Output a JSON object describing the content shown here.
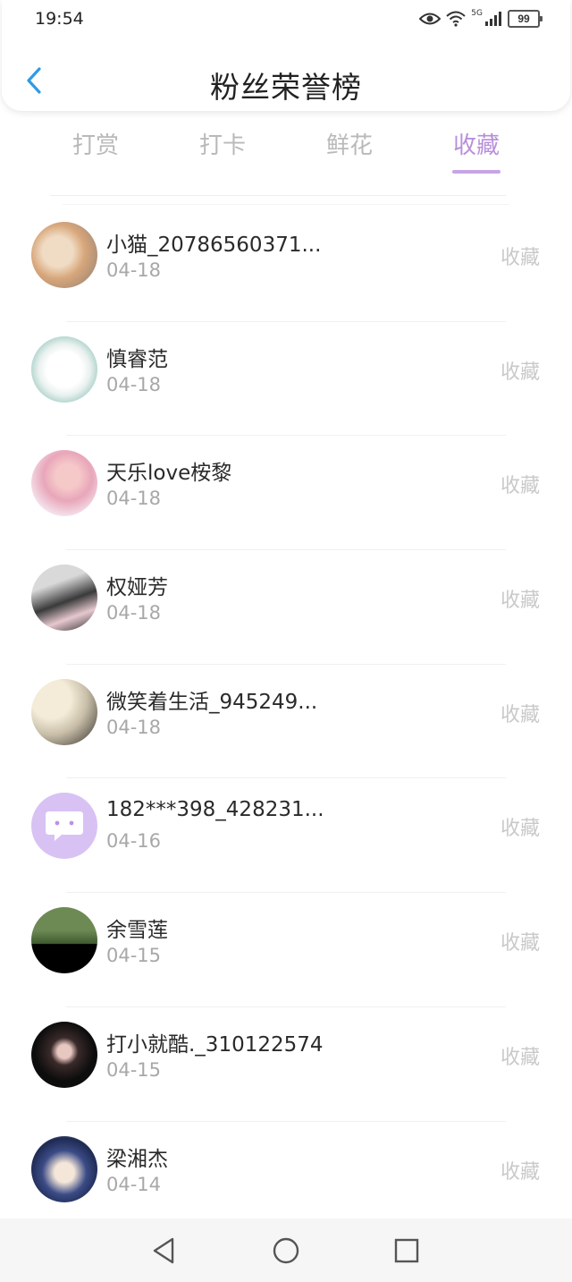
{
  "status_bar": {
    "time": "19:54",
    "signal_label": "5G",
    "battery": "99"
  },
  "header": {
    "title": "粉丝荣誉榜"
  },
  "tabs": [
    {
      "label": "打赏",
      "active": false
    },
    {
      "label": "打卡",
      "active": false
    },
    {
      "label": "鲜花",
      "active": false
    },
    {
      "label": "收藏",
      "active": true
    }
  ],
  "fans": [
    {
      "name": "小猫_20786560371...",
      "date": "04-18",
      "action": "收藏"
    },
    {
      "name": "慎睿范",
      "date": "04-18",
      "action": "收藏"
    },
    {
      "name": "天乐love桉黎",
      "date": "04-18",
      "action": "收藏"
    },
    {
      "name": "权娅芳",
      "date": "04-18",
      "action": "收藏"
    },
    {
      "name": "微笑着生活_945249...",
      "date": "04-18",
      "action": "收藏"
    },
    {
      "name": "182***398_428231...",
      "date": "04-16",
      "action": "收藏"
    },
    {
      "name": "余雪莲",
      "date": "04-15",
      "action": "收藏"
    },
    {
      "name": "打小就酷._310122574",
      "date": "04-15",
      "action": "收藏"
    },
    {
      "name": "梁湘杰",
      "date": "04-14",
      "action": "收藏"
    }
  ],
  "colors": {
    "accent": "#b88fda",
    "inactive_tab": "#b9b9b9",
    "muted": "#c9c9c9"
  },
  "icons": {
    "back": "chevron-left-icon",
    "eye": "eye-icon",
    "wifi": "wifi-icon",
    "signal": "signal-bars-icon",
    "battery": "battery-icon",
    "nav_back": "triangle-back-icon",
    "nav_home": "circle-home-icon",
    "nav_recents": "square-recents-icon"
  }
}
